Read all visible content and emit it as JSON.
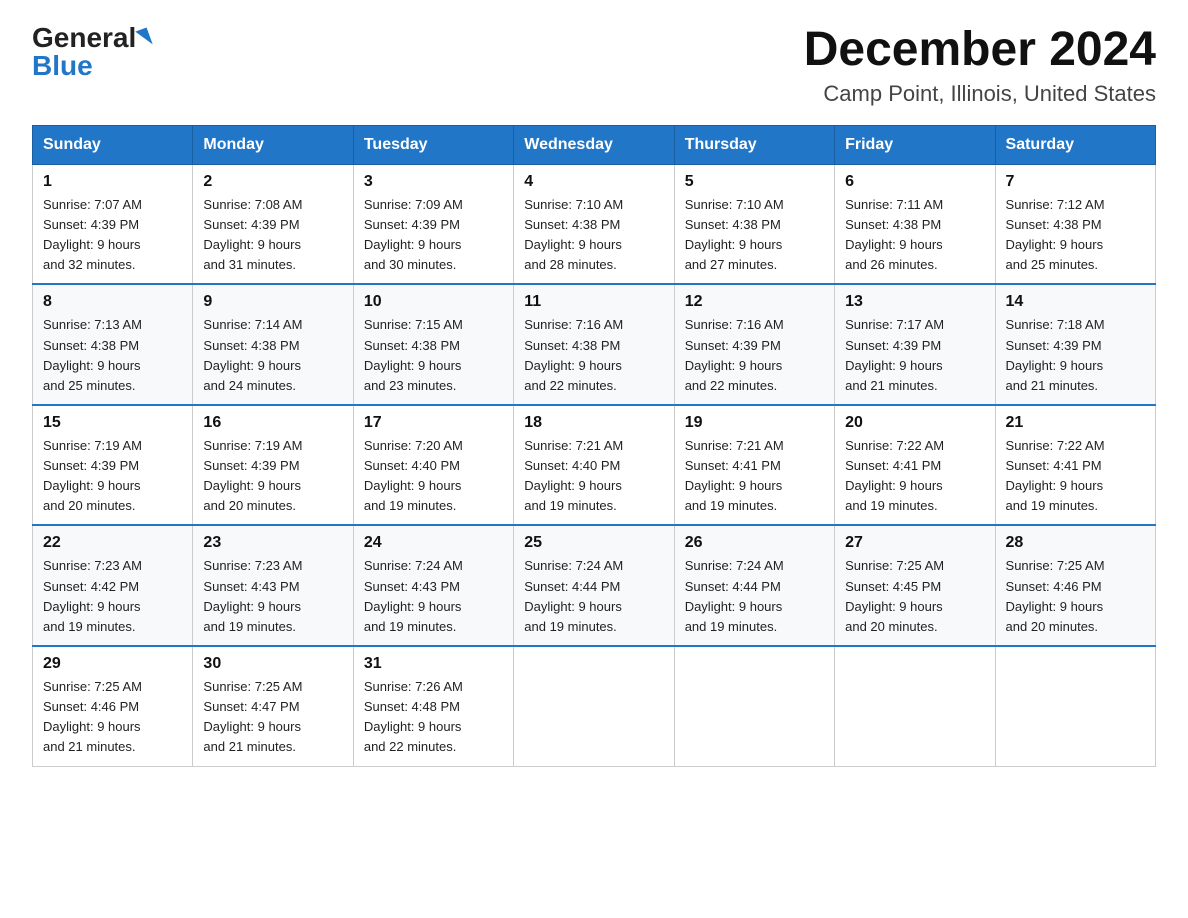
{
  "logo": {
    "text_general": "General",
    "text_blue": "Blue",
    "triangle": "▶"
  },
  "title": {
    "month": "December 2024",
    "location": "Camp Point, Illinois, United States"
  },
  "header": {
    "days": [
      "Sunday",
      "Monday",
      "Tuesday",
      "Wednesday",
      "Thursday",
      "Friday",
      "Saturday"
    ]
  },
  "weeks": [
    [
      {
        "day": "1",
        "sunrise": "7:07 AM",
        "sunset": "4:39 PM",
        "daylight": "9 hours and 32 minutes."
      },
      {
        "day": "2",
        "sunrise": "7:08 AM",
        "sunset": "4:39 PM",
        "daylight": "9 hours and 31 minutes."
      },
      {
        "day": "3",
        "sunrise": "7:09 AM",
        "sunset": "4:39 PM",
        "daylight": "9 hours and 30 minutes."
      },
      {
        "day": "4",
        "sunrise": "7:10 AM",
        "sunset": "4:38 PM",
        "daylight": "9 hours and 28 minutes."
      },
      {
        "day": "5",
        "sunrise": "7:10 AM",
        "sunset": "4:38 PM",
        "daylight": "9 hours and 27 minutes."
      },
      {
        "day": "6",
        "sunrise": "7:11 AM",
        "sunset": "4:38 PM",
        "daylight": "9 hours and 26 minutes."
      },
      {
        "day": "7",
        "sunrise": "7:12 AM",
        "sunset": "4:38 PM",
        "daylight": "9 hours and 25 minutes."
      }
    ],
    [
      {
        "day": "8",
        "sunrise": "7:13 AM",
        "sunset": "4:38 PM",
        "daylight": "9 hours and 25 minutes."
      },
      {
        "day": "9",
        "sunrise": "7:14 AM",
        "sunset": "4:38 PM",
        "daylight": "9 hours and 24 minutes."
      },
      {
        "day": "10",
        "sunrise": "7:15 AM",
        "sunset": "4:38 PM",
        "daylight": "9 hours and 23 minutes."
      },
      {
        "day": "11",
        "sunrise": "7:16 AM",
        "sunset": "4:38 PM",
        "daylight": "9 hours and 22 minutes."
      },
      {
        "day": "12",
        "sunrise": "7:16 AM",
        "sunset": "4:39 PM",
        "daylight": "9 hours and 22 minutes."
      },
      {
        "day": "13",
        "sunrise": "7:17 AM",
        "sunset": "4:39 PM",
        "daylight": "9 hours and 21 minutes."
      },
      {
        "day": "14",
        "sunrise": "7:18 AM",
        "sunset": "4:39 PM",
        "daylight": "9 hours and 21 minutes."
      }
    ],
    [
      {
        "day": "15",
        "sunrise": "7:19 AM",
        "sunset": "4:39 PM",
        "daylight": "9 hours and 20 minutes."
      },
      {
        "day": "16",
        "sunrise": "7:19 AM",
        "sunset": "4:39 PM",
        "daylight": "9 hours and 20 minutes."
      },
      {
        "day": "17",
        "sunrise": "7:20 AM",
        "sunset": "4:40 PM",
        "daylight": "9 hours and 19 minutes."
      },
      {
        "day": "18",
        "sunrise": "7:21 AM",
        "sunset": "4:40 PM",
        "daylight": "9 hours and 19 minutes."
      },
      {
        "day": "19",
        "sunrise": "7:21 AM",
        "sunset": "4:41 PM",
        "daylight": "9 hours and 19 minutes."
      },
      {
        "day": "20",
        "sunrise": "7:22 AM",
        "sunset": "4:41 PM",
        "daylight": "9 hours and 19 minutes."
      },
      {
        "day": "21",
        "sunrise": "7:22 AM",
        "sunset": "4:41 PM",
        "daylight": "9 hours and 19 minutes."
      }
    ],
    [
      {
        "day": "22",
        "sunrise": "7:23 AM",
        "sunset": "4:42 PM",
        "daylight": "9 hours and 19 minutes."
      },
      {
        "day": "23",
        "sunrise": "7:23 AM",
        "sunset": "4:43 PM",
        "daylight": "9 hours and 19 minutes."
      },
      {
        "day": "24",
        "sunrise": "7:24 AM",
        "sunset": "4:43 PM",
        "daylight": "9 hours and 19 minutes."
      },
      {
        "day": "25",
        "sunrise": "7:24 AM",
        "sunset": "4:44 PM",
        "daylight": "9 hours and 19 minutes."
      },
      {
        "day": "26",
        "sunrise": "7:24 AM",
        "sunset": "4:44 PM",
        "daylight": "9 hours and 19 minutes."
      },
      {
        "day": "27",
        "sunrise": "7:25 AM",
        "sunset": "4:45 PM",
        "daylight": "9 hours and 20 minutes."
      },
      {
        "day": "28",
        "sunrise": "7:25 AM",
        "sunset": "4:46 PM",
        "daylight": "9 hours and 20 minutes."
      }
    ],
    [
      {
        "day": "29",
        "sunrise": "7:25 AM",
        "sunset": "4:46 PM",
        "daylight": "9 hours and 21 minutes."
      },
      {
        "day": "30",
        "sunrise": "7:25 AM",
        "sunset": "4:47 PM",
        "daylight": "9 hours and 21 minutes."
      },
      {
        "day": "31",
        "sunrise": "7:26 AM",
        "sunset": "4:48 PM",
        "daylight": "9 hours and 22 minutes."
      },
      null,
      null,
      null,
      null
    ]
  ],
  "labels": {
    "sunrise": "Sunrise: ",
    "sunset": "Sunset: ",
    "daylight": "Daylight: "
  }
}
